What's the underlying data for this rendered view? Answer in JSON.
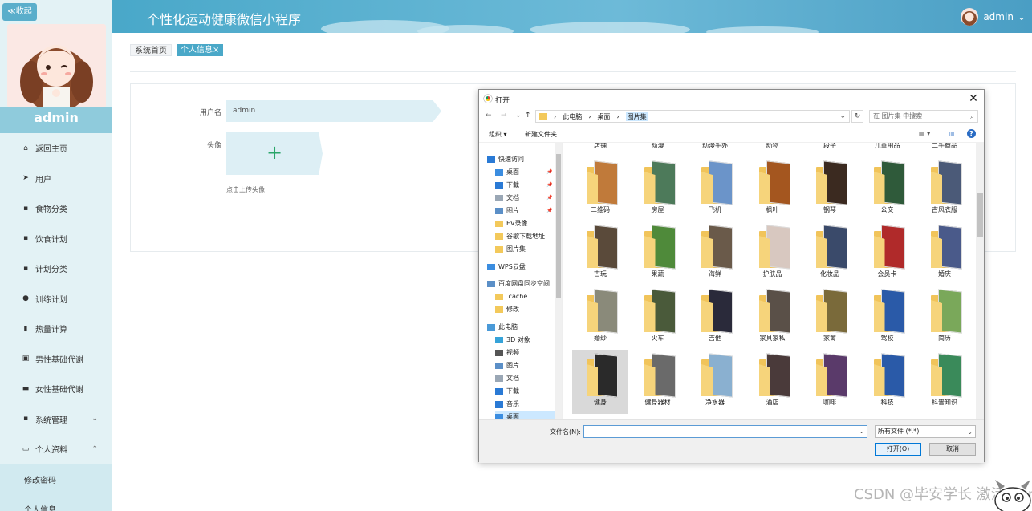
{
  "sidebar": {
    "collapse_label": "≪收起",
    "username": "admin",
    "menu": [
      {
        "label": "返回主页",
        "icon": "home-icon",
        "glyph": "⌂"
      },
      {
        "label": "用户",
        "icon": "send-icon",
        "glyph": "➤"
      },
      {
        "label": "食物分类",
        "icon": "grid-icon",
        "glyph": "▪"
      },
      {
        "label": "饮食计划",
        "icon": "grid-icon",
        "glyph": "▪"
      },
      {
        "label": "计划分类",
        "icon": "grid-icon",
        "glyph": "▪"
      },
      {
        "label": "训练计划",
        "icon": "pin-icon",
        "glyph": "●"
      },
      {
        "label": "热量计算",
        "icon": "bar-chart-icon",
        "glyph": "▮"
      },
      {
        "label": "男性基础代谢",
        "icon": "clipboard-icon",
        "glyph": "▣"
      },
      {
        "label": "女性基础代谢",
        "icon": "database-icon",
        "glyph": "▬"
      },
      {
        "label": "系统管理",
        "icon": "grid-icon",
        "glyph": "▪",
        "arrow": "⌄"
      },
      {
        "label": "个人资料",
        "icon": "calendar-icon",
        "glyph": "▭",
        "arrow": "⌃"
      }
    ],
    "submenu": [
      "修改密码",
      "个人信息"
    ]
  },
  "header": {
    "title": "个性化运动健康微信小程序",
    "user": "admin",
    "user_arrow": "⌄"
  },
  "tabs": [
    {
      "label": "系统首页"
    },
    {
      "label": "个人信息×"
    }
  ],
  "form": {
    "username_label": "用户名",
    "username_value": "admin",
    "avatar_label": "头像",
    "upload_plus": "+",
    "upload_hint": "点击上传头像"
  },
  "dialog": {
    "title": "打开",
    "close": "✕",
    "nav": {
      "back": "←",
      "forward": "→",
      "down": "⌄",
      "up": "↑"
    },
    "breadcrumb": [
      "此电脑",
      "桌面",
      "图片集"
    ],
    "breadcrumb_sep": "›",
    "address_dropdown": "⌄",
    "refresh": "↻",
    "search_placeholder": "在 图片集 中搜索",
    "search_icon": "⌕",
    "organize": "组织 ▾",
    "new_folder": "新建文件夹",
    "view_icon": "▤ ▾",
    "pane_icon": "▥",
    "help": "?",
    "tree": [
      {
        "label": "快速访问",
        "icon": "star-icon",
        "color": "#2a7ad5"
      },
      {
        "label": "桌面",
        "icon": "desktop-icon",
        "color": "#3b8de0",
        "pinned": "📌"
      },
      {
        "label": "下载",
        "icon": "download-icon",
        "color": "#2a7ad5",
        "pinned": "📌"
      },
      {
        "label": "文档",
        "icon": "document-icon",
        "color": "#9aa7b5",
        "pinned": "📌"
      },
      {
        "label": "图片",
        "icon": "picture-icon",
        "color": "#5b8fc7",
        "pinned": "📌"
      },
      {
        "label": "EV录像",
        "icon": "folder-icon",
        "color": "#f3c95b"
      },
      {
        "label": "谷歌下载地址",
        "icon": "folder-icon",
        "color": "#f3c95b"
      },
      {
        "label": "图片集",
        "icon": "folder-icon",
        "color": "#f3c95b"
      },
      {
        "label": "WPS云盘",
        "icon": "cloud-icon",
        "color": "#3b8de0"
      },
      {
        "label": "百度网盘同步空间",
        "icon": "baidu-icon",
        "color": "#5b8fc7"
      },
      {
        "label": ".cache",
        "icon": "folder-icon",
        "color": "#f3c95b"
      },
      {
        "label": "修改",
        "icon": "folder-icon",
        "color": "#f3c95b"
      },
      {
        "label": "此电脑",
        "icon": "computer-icon",
        "color": "#4a9ad8"
      },
      {
        "label": "3D 对象",
        "icon": "3d-icon",
        "color": "#36a3d9"
      },
      {
        "label": "视频",
        "icon": "video-icon",
        "color": "#555"
      },
      {
        "label": "图片",
        "icon": "picture-icon",
        "color": "#5b8fc7"
      },
      {
        "label": "文档",
        "icon": "document-icon",
        "color": "#9aa7b5"
      },
      {
        "label": "下载",
        "icon": "download-icon",
        "color": "#2a7ad5"
      },
      {
        "label": "音乐",
        "icon": "music-icon",
        "color": "#2a7ad5"
      },
      {
        "label": "桌面",
        "icon": "desktop-icon",
        "color": "#3b8de0"
      }
    ],
    "folders": [
      {
        "label": "店铺",
        "color": "#8a6d4b"
      },
      {
        "label": "动漫",
        "color": "#6f7fa0"
      },
      {
        "label": "动漫手办",
        "color": "#a06a8f"
      },
      {
        "label": "动物",
        "color": "#7e6a44"
      },
      {
        "label": "段子",
        "color": "#555"
      },
      {
        "label": "儿童用品",
        "color": "#8aa0c0"
      },
      {
        "label": "二手商品",
        "color": "#6b6b6b"
      },
      {
        "label": "二维码",
        "color": "#c07a3a"
      },
      {
        "label": "房屋",
        "color": "#4d7a5a"
      },
      {
        "label": "飞机",
        "color": "#6b94c9"
      },
      {
        "label": "枫叶",
        "color": "#a4561f"
      },
      {
        "label": "钢琴",
        "color": "#3b2a20"
      },
      {
        "label": "公交",
        "color": "#2f5a3a"
      },
      {
        "label": "古风衣服",
        "color": "#4b5a78"
      },
      {
        "label": "古玩",
        "color": "#5a4a3a"
      },
      {
        "label": "果蔬",
        "color": "#4f8a3a"
      },
      {
        "label": "海鲜",
        "color": "#6a5a4a"
      },
      {
        "label": "护肤品",
        "color": "#d8c8c0"
      },
      {
        "label": "化妆品",
        "color": "#3a4a6a"
      },
      {
        "label": "会员卡",
        "color": "#b02a2a"
      },
      {
        "label": "婚庆",
        "color": "#4a5a8a"
      },
      {
        "label": "婚纱",
        "color": "#8a8a7a"
      },
      {
        "label": "火车",
        "color": "#4a5a3a"
      },
      {
        "label": "吉他",
        "color": "#2a2a3a"
      },
      {
        "label": "家具家私",
        "color": "#5a5048"
      },
      {
        "label": "家禽",
        "color": "#7a6a3a"
      },
      {
        "label": "驾校",
        "color": "#2a5aa8"
      },
      {
        "label": "简历",
        "color": "#7aa85a"
      },
      {
        "label": "健身",
        "color": "#2a2a2a"
      },
      {
        "label": "健身器材",
        "color": "#6a6a6a"
      },
      {
        "label": "净水器",
        "color": "#8ab0d0"
      },
      {
        "label": "酒店",
        "color": "#4a3a3a"
      },
      {
        "label": "咖啡",
        "color": "#5a3a6a"
      },
      {
        "label": "科技",
        "color": "#2a5aa8"
      },
      {
        "label": "科普知识",
        "color": "#3a8a5a"
      }
    ],
    "filename_label": "文件名(N):",
    "filename_value": "",
    "filename_dropdown": "⌄",
    "filetype": "所有文件 (*.*)",
    "filetype_dropdown": "⌄",
    "open_button": "打开(O)",
    "cancel_button": "取消"
  },
  "watermark": "CSDN @毕安学长 激活 Windows"
}
